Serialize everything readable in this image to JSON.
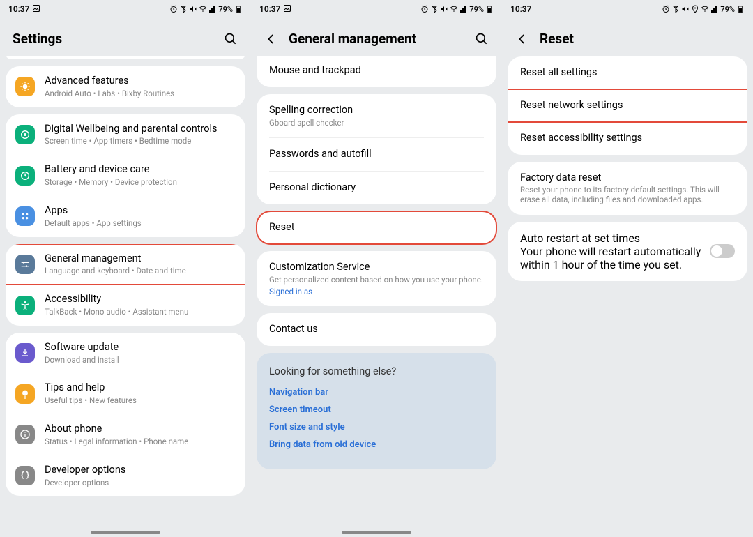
{
  "status": {
    "time": "10:37",
    "battery": "79%"
  },
  "screen1": {
    "title": "Settings",
    "items": [
      {
        "title": "Advanced features",
        "sub": "Android Auto  •  Labs  •  Bixby Routines"
      },
      {
        "title": "Digital Wellbeing and parental controls",
        "sub": "Screen time  •  App timers  •  Bedtime mode"
      },
      {
        "title": "Battery and device care",
        "sub": "Storage  •  Memory  •  Device protection"
      },
      {
        "title": "Apps",
        "sub": "Default apps  •  App settings"
      },
      {
        "title": "General management",
        "sub": "Language and keyboard  •  Date and time"
      },
      {
        "title": "Accessibility",
        "sub": "TalkBack  •  Mono audio  •  Assistant menu"
      },
      {
        "title": "Software update",
        "sub": "Download and install"
      },
      {
        "title": "Tips and help",
        "sub": "Useful tips  •  New features"
      },
      {
        "title": "About phone",
        "sub": "Status  •  Legal information  •  Phone name"
      },
      {
        "title": "Developer options",
        "sub": "Developer options"
      }
    ]
  },
  "screen2": {
    "title": "General management",
    "items": [
      {
        "title": "Mouse and trackpad"
      },
      {
        "title": "Spelling correction",
        "sub": "Gboard spell checker"
      },
      {
        "title": "Passwords and autofill"
      },
      {
        "title": "Personal dictionary"
      },
      {
        "title": "Reset"
      },
      {
        "title": "Customization Service",
        "sub": "Get personalized content based on how you use your phone.",
        "link": "Signed in as"
      },
      {
        "title": "Contact us"
      }
    ],
    "looking": {
      "q": "Looking for something else?",
      "links": [
        "Navigation bar",
        "Screen timeout",
        "Font size and style",
        "Bring data from old device"
      ]
    }
  },
  "screen3": {
    "title": "Reset",
    "g1": [
      {
        "title": "Reset all settings"
      },
      {
        "title": "Reset network settings"
      },
      {
        "title": "Reset accessibility settings"
      }
    ],
    "g2": [
      {
        "title": "Factory data reset",
        "sub": "Reset your phone to its factory default settings. This will erase all data, including files and downloaded apps."
      }
    ],
    "g3": [
      {
        "title": "Auto restart at set times",
        "sub": "Your phone will restart automatically within 1 hour of the time you set."
      }
    ]
  }
}
